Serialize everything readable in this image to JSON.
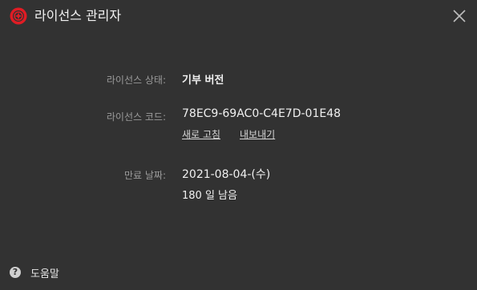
{
  "window": {
    "title": "라이선스 관리자",
    "logo_icon": "app-logo-icon",
    "close_icon": "close-icon"
  },
  "license": {
    "status_label": "라이선스 상태:",
    "status_value": "기부 버전",
    "code_label": "라이선스 코드:",
    "code_value": "78EC9-69AC0-C4E7D-01E48",
    "refresh_link": "새로 고침",
    "export_link": "내보내기",
    "expiry_label": "만료 날짜:",
    "expiry_value": "2021-08-04-(수)",
    "remaining_value": "180 일 남음"
  },
  "footer": {
    "help_icon_glyph": "?",
    "help_label": "도움말"
  },
  "colors": {
    "background": "#323232",
    "logo_red": "#e01c24",
    "label_gray": "#9a9a9a",
    "value_white": "#f0f0f0"
  }
}
